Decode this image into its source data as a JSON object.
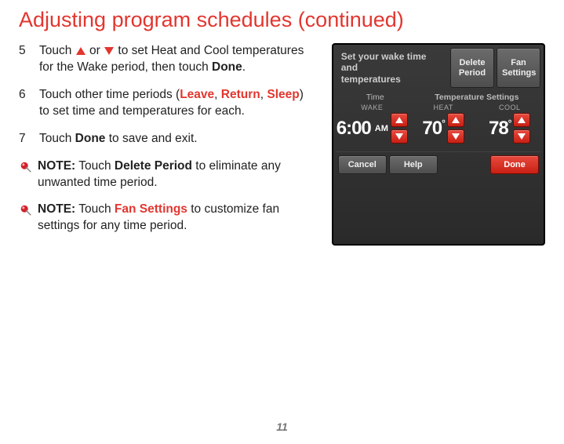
{
  "title": "Adjusting program schedules (continued)",
  "steps": {
    "s5": {
      "num": "5",
      "pre": "Touch ",
      "mid": " or ",
      "post": " to set Heat and Cool temperatures for the Wake period, then touch ",
      "done": "Done",
      "end": "."
    },
    "s6": {
      "num": "6",
      "pre": "Touch other time periods (",
      "leave": "Leave",
      "c1": ", ",
      "return": "Return",
      "c2": ", ",
      "sleep": "Sleep",
      "post": ") to set time and temperatures for each."
    },
    "s7": {
      "num": "7",
      "pre": "Touch ",
      "done": "Done",
      "post": " to save and exit."
    }
  },
  "notes": {
    "n1": {
      "label": "NOTE:",
      "pre": " Touch ",
      "bold": "Delete Period",
      "post": " to eliminate any unwanted time period."
    },
    "n2": {
      "label": "NOTE:",
      "pre": " Touch ",
      "bold": "Fan Settings",
      "post": " to customize fan settings for any time period."
    }
  },
  "thermostat": {
    "header_msg_l1": "Set your wake time and",
    "header_msg_l2": "temperatures",
    "delete_l1": "Delete",
    "delete_l2": "Period",
    "fan_l1": "Fan",
    "fan_l2": "Settings",
    "label_time": "Time",
    "label_temp": "Temperature Settings",
    "wake_label": "WAKE",
    "time_value": "6:00",
    "time_ampm": "AM",
    "heat_label": "HEAT",
    "heat_value": "70",
    "cool_label": "COOL",
    "cool_value": "78",
    "cancel": "Cancel",
    "help": "Help",
    "done": "Done"
  },
  "page_number": "11"
}
